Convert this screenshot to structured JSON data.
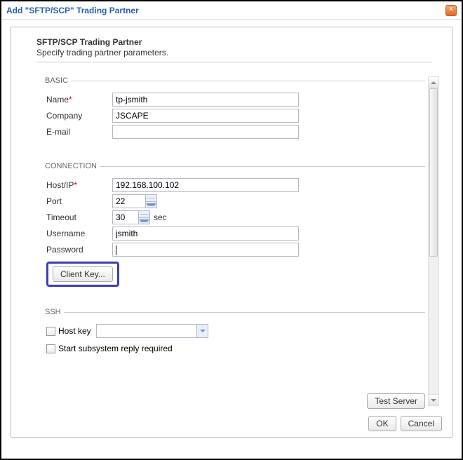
{
  "dialog": {
    "title": "Add \"SFTP/SCP\" Trading Partner"
  },
  "header": {
    "title": "SFTP/SCP Trading Partner",
    "subtitle": "Specify trading partner parameters."
  },
  "groups": {
    "basic": {
      "legend": "BASIC",
      "name_label": "Name",
      "name_value": "tp-jsmith",
      "company_label": "Company",
      "company_value": "JSCAPE",
      "email_label": "E-mail",
      "email_value": ""
    },
    "connection": {
      "legend": "CONNECTION",
      "host_label": "Host/IP",
      "host_value": "192.168.100.102",
      "port_label": "Port",
      "port_value": "22",
      "timeout_label": "Timeout",
      "timeout_value": "30",
      "timeout_unit": "sec",
      "user_label": "Username",
      "user_value": "jsmith",
      "password_label": "Password",
      "password_value": "",
      "client_key_label": "Client Key..."
    },
    "ssh": {
      "legend": "SSH",
      "hostkey_label": "Host key",
      "hostkey_value": "",
      "subsys_label": "Start subsystem reply required"
    }
  },
  "buttons": {
    "test_server": "Test Server",
    "ok": "OK",
    "cancel": "Cancel"
  }
}
